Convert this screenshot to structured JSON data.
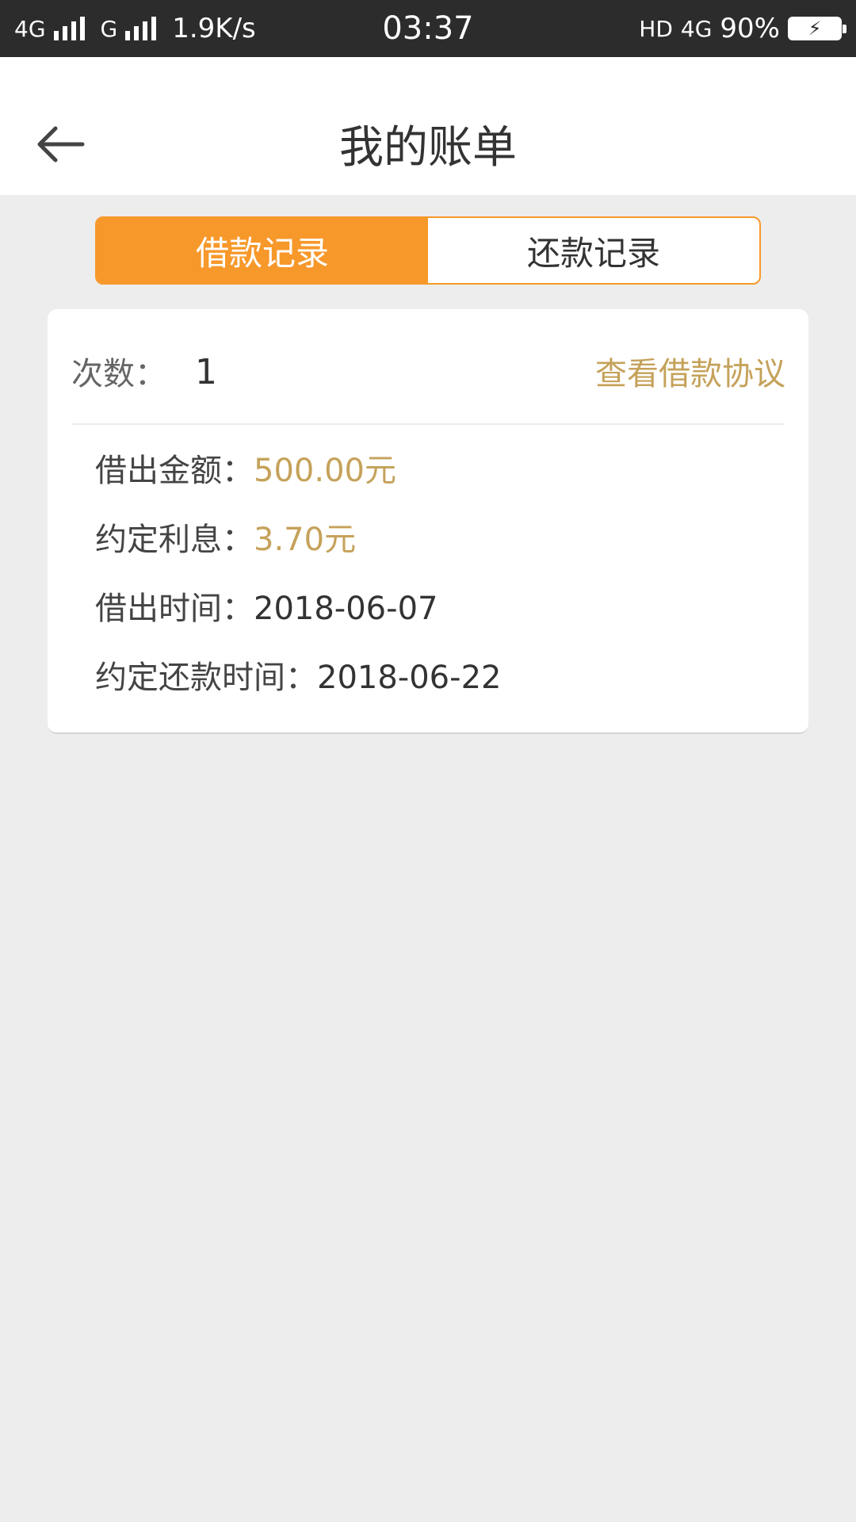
{
  "status_bar": {
    "network1": "4G",
    "network2": "G",
    "speed": "1.9K/s",
    "time": "03:37",
    "hd": "HD",
    "network3": "4G",
    "battery": "90%"
  },
  "header": {
    "title": "我的账单",
    "back_icon": "arrow-left-icon"
  },
  "tabs": [
    {
      "label": "借款记录",
      "active": true
    },
    {
      "label": "还款记录",
      "active": false
    }
  ],
  "record": {
    "count_label": "次数：",
    "count_value": "1",
    "agreement_link": "查看借款协议",
    "rows": [
      {
        "label": "借出金额：",
        "value": "500.00元"
      },
      {
        "label": "约定利息：",
        "value": "3.70元"
      },
      {
        "label": "借出时间：",
        "value": "2018-06-07"
      },
      {
        "label": "约定还款时间：",
        "value": "2018-06-22"
      }
    ]
  },
  "colors": {
    "accent": "#f7982a",
    "gold_text": "#c5a25a",
    "background": "#ededed",
    "status_bar": "#2c2c2c"
  }
}
